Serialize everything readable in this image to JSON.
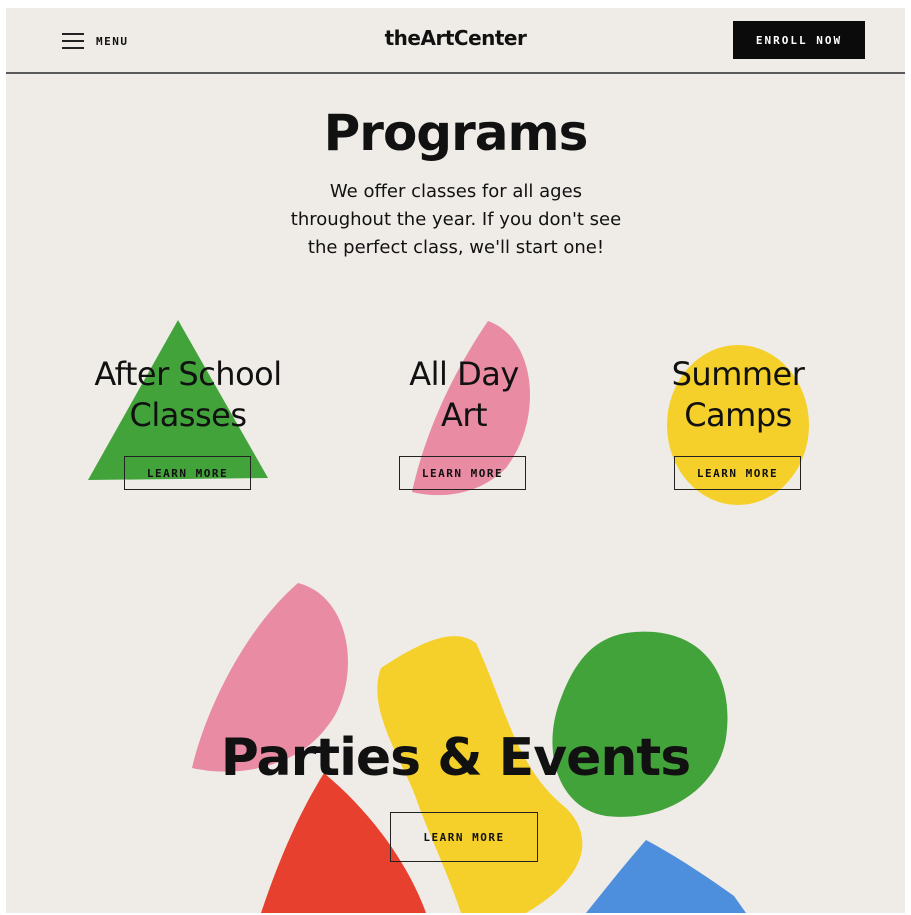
{
  "header": {
    "menu_label": "MENU",
    "logo": "theArtCenter",
    "enroll_label": "ENROLL NOW"
  },
  "programs": {
    "title": "Programs",
    "intro_lines": [
      "We offer classes for all ages",
      "throughout the year. If you don't see",
      "the perfect class, we'll start one!"
    ],
    "items": [
      {
        "title_lines": [
          "After School",
          "Classes"
        ],
        "button": "LEARN MORE",
        "shape_color": "#43a33b"
      },
      {
        "title_lines": [
          "All Day",
          "Art"
        ],
        "button": "LEARN MORE",
        "shape_color": "#e88ba3"
      },
      {
        "title_lines": [
          "Summer",
          "Camps"
        ],
        "button": "LEARN MORE",
        "shape_color": "#f6d02a"
      }
    ]
  },
  "parties": {
    "title": "Parties & Events",
    "button": "LEARN MORE"
  },
  "colors": {
    "background": "#efece7",
    "green": "#43a33b",
    "pink": "#e88ba3",
    "yellow": "#f6d02a",
    "red": "#e8402f",
    "blue": "#4d8fdc",
    "ink": "#111111"
  }
}
